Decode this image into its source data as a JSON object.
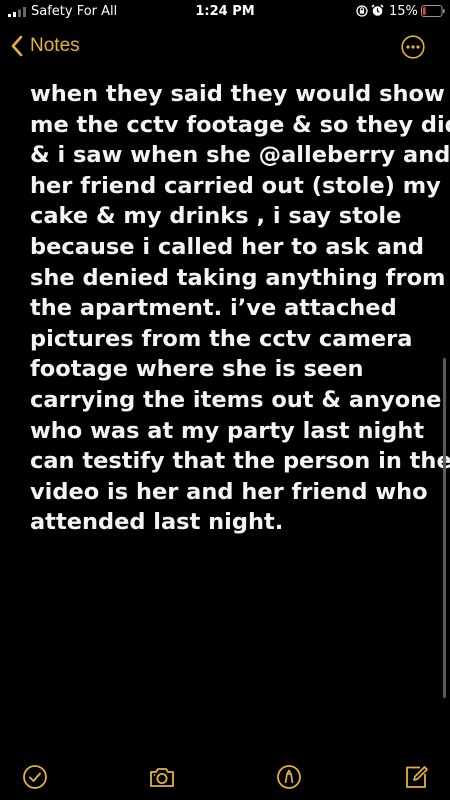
{
  "status_bar": {
    "carrier": "Safety For All",
    "time": "1:24 PM",
    "battery_percent": "15%",
    "battery_level": 0.15,
    "icons": [
      "signal-icon",
      "rotation-lock-icon",
      "alarm-icon",
      "battery-icon"
    ]
  },
  "nav": {
    "back_label": "Notes",
    "icons": [
      "chevron-left-icon",
      "more-icon"
    ]
  },
  "note": {
    "lines": [
      "when they said they would show",
      "me the cctv footage & so they did",
      "& i saw when she @alleberry and",
      "her friend carried out (stole) my",
      "cake & my drinks , i say stole",
      "because i called her to ask and",
      "she denied taking anything from",
      "the apartment. i’ve attached",
      "pictures from the cctv camera",
      "footage where she is seen",
      "carrying the items out & anyone",
      "who was at my party last night",
      "can testify that the person in the",
      "video is her and her friend who",
      "attended last night."
    ]
  },
  "toolbar": {
    "icons": [
      "checklist-icon",
      "camera-icon",
      "markup-icon",
      "compose-icon"
    ]
  },
  "colors": {
    "accent": "#e2b23b",
    "background": "#000000",
    "text": "#f4f4f4",
    "battery_low": "#e0433a"
  }
}
